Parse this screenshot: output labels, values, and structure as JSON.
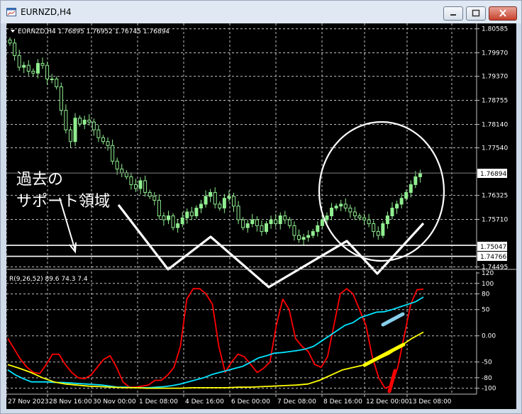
{
  "window": {
    "title": "EURNZD,H4",
    "buttons": {
      "minimize": "minimize-icon",
      "maximize": "maximize-icon",
      "close": "close-icon"
    }
  },
  "chart": {
    "header": "EURNZD,H4  1.76895 1.76952 1.76745 1.76894",
    "price_axis_labels": [
      "1.80585",
      "1.79970",
      "1.79370",
      "1.78755",
      "1.78140",
      "1.77540",
      "1.76325",
      "1.75710",
      "1.74495"
    ],
    "current_price_tag": "1.76894",
    "level_tags": [
      "1.75047",
      "1.74766"
    ],
    "time_axis_labels": [
      "27 Nov 2023",
      "28 Nov 16:00",
      "30 Nov 00:00",
      "1 Dec 08:00",
      "4 Dec 16:00",
      "6 Dec 00:00",
      "7 Dec 08:00",
      "8 Dec 16:00",
      "12 Dec 00:00",
      "13 Dec 08:00"
    ]
  },
  "indicator": {
    "header": "R(9,26,52) 89.6 74.3 7.4",
    "axis_labels": [
      "120",
      "100",
      "80",
      "50",
      "0.00",
      "-50",
      "-80",
      "-100"
    ]
  },
  "annotation": {
    "line1": "過去の",
    "line2": "サポート領域"
  },
  "colors": {
    "background": "#000000",
    "bull_candle": "#90ee90",
    "grid": "#c0c0c0",
    "indicator_fast": "#ff0000",
    "indicator_mid": "#00e5ff",
    "indicator_slow": "#ffff00",
    "drawing": "#ffffff"
  },
  "chart_data": [
    {
      "type": "candlestick",
      "title": "EURNZD,H4",
      "ylim": [
        1.7445,
        1.8065
      ],
      "close_series": [
        1.8022,
        1.799,
        1.796,
        1.7965,
        1.795,
        1.7945,
        1.797,
        1.7965,
        1.793,
        1.793,
        1.791,
        1.785,
        1.78,
        1.777,
        1.783,
        1.7815,
        1.7825,
        1.782,
        1.78,
        1.778,
        1.777,
        1.776,
        1.772,
        1.77,
        1.769,
        1.768,
        1.766,
        1.765,
        1.767,
        1.764,
        1.763,
        1.762,
        1.758,
        1.757,
        1.758,
        1.755,
        1.756,
        1.7575,
        1.759,
        1.758,
        1.76,
        1.761,
        1.763,
        1.764,
        1.761,
        1.76,
        1.7625,
        1.763,
        1.7605,
        1.757,
        1.755,
        1.756,
        1.757,
        1.7555,
        1.754,
        1.756,
        1.757,
        1.756,
        1.758,
        1.757,
        1.7555,
        1.753,
        1.752,
        1.7525,
        1.753,
        1.754,
        1.7555,
        1.757,
        1.758,
        1.76,
        1.7605,
        1.761,
        1.76,
        1.759,
        1.758,
        1.7575,
        1.757,
        1.756,
        1.754,
        1.753,
        1.756,
        1.758,
        1.76,
        1.761,
        1.7625,
        1.764,
        1.766,
        1.768,
        1.7689
      ],
      "levels": [
        1.75047,
        1.74766
      ],
      "current": 1.76894
    },
    {
      "type": "line",
      "title": "R(9,26,52)",
      "ylim": [
        -110,
        120
      ],
      "series": [
        {
          "values": [
            -5,
            -25,
            -45,
            -60,
            -70,
            -72,
            -55,
            -35,
            -35,
            -55,
            -70,
            -80,
            -82,
            -75,
            -60,
            -45,
            -38,
            -60,
            -88,
            -98,
            -98,
            -96,
            -94,
            -85,
            -85,
            -75,
            -60,
            -20,
            70,
            90,
            90,
            80,
            60,
            -20,
            -70,
            -50,
            -35,
            -40,
            -55,
            -70,
            -62,
            -50,
            20,
            70,
            50,
            -5,
            -20,
            -30,
            -55,
            -60,
            -40,
            20,
            80,
            90,
            80,
            50,
            20,
            -40,
            -80,
            -100,
            -95,
            -60,
            0,
            60,
            88,
            89
          ]
        },
        {
          "values": [
            -65,
            -75,
            -82,
            -88,
            -88,
            -88,
            -89,
            -89,
            -90,
            -91,
            -92,
            -93,
            -94,
            -96,
            -98,
            -98,
            -99,
            -99,
            -99,
            -98,
            -97,
            -95,
            -92,
            -88,
            -84,
            -80,
            -74,
            -70,
            -66,
            -62,
            -58,
            -50,
            -42,
            -38,
            -33,
            -32,
            -30,
            -28,
            -25,
            -20,
            -10,
            0,
            10,
            20,
            25,
            35,
            40,
            45,
            46,
            50,
            55,
            60,
            65,
            74
          ]
        },
        {
          "values": [
            -55,
            -62,
            -70,
            -80,
            -88,
            -92,
            -94,
            -96,
            -97,
            -98,
            -99,
            -99,
            -100,
            -100,
            -100,
            -100,
            -99,
            -99,
            -99,
            -99,
            -98,
            -98,
            -97,
            -96,
            -95,
            -94,
            -92,
            -85,
            -75,
            -65,
            -60,
            -55,
            -45,
            -35,
            -20,
            -5,
            7
          ]
        }
      ]
    }
  ]
}
